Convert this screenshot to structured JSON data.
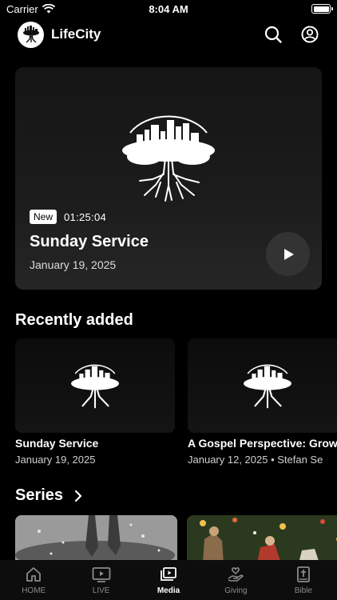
{
  "status": {
    "carrier": "Carrier",
    "time": "8:04 AM",
    "battery_level": 1.0
  },
  "header": {
    "title": "LifeCity",
    "search_icon": "search-icon",
    "profile_icon": "profile-icon"
  },
  "hero": {
    "badge": "New",
    "duration": "01:25:04",
    "title": "Sunday Service",
    "date": "January 19, 2025"
  },
  "recently_added": {
    "heading": "Recently added",
    "items": [
      {
        "title": "Sunday Service",
        "date": "January 19, 2025"
      },
      {
        "title": "A Gospel Perspective: Grow",
        "date": "January 12, 2025 • Stefan Se"
      }
    ]
  },
  "series": {
    "heading": "Series",
    "items": [
      {
        "image": "rainy-feet"
      },
      {
        "image": "nativity-lights"
      }
    ]
  },
  "tabs": [
    {
      "label": "HOME",
      "icon": "home-icon",
      "active": false
    },
    {
      "label": "LIVE",
      "icon": "tv-play-icon",
      "active": false
    },
    {
      "label": "Media",
      "icon": "media-icon",
      "active": true
    },
    {
      "label": "Giving",
      "icon": "giving-icon",
      "active": false
    },
    {
      "label": "Bible",
      "icon": "bible-icon",
      "active": false
    }
  ],
  "colors": {
    "background": "#000000",
    "card": "#1c1c1c",
    "text": "#ffffff",
    "muted": "#8a8a8a"
  }
}
